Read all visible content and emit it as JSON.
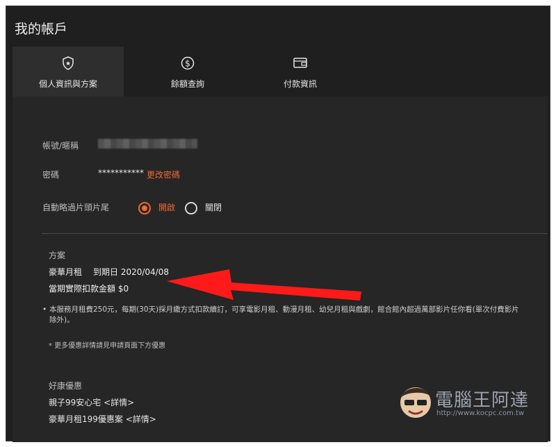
{
  "page": {
    "title": "我的帳戶"
  },
  "tabs": [
    {
      "label": "個人資訊與方案",
      "icon": "shield-icon",
      "active": true
    },
    {
      "label": "餘額查詢",
      "icon": "dollar-icon",
      "active": false
    },
    {
      "label": "付款資訊",
      "icon": "wallet-icon",
      "active": false
    }
  ],
  "account": {
    "nickname_label": "帳號/暱稱",
    "password_label": "密碼",
    "password_value": "***********",
    "change_password": "更改密碼",
    "skip_label": "自動略過片頭片尾",
    "skip_on": "開啟",
    "skip_off": "關閉",
    "skip_selected": "on"
  },
  "plan": {
    "section_label": "方案",
    "name": "豪華月租",
    "expiry": "到期日 2020/04/08",
    "charge": "當期實際扣款金額 $0",
    "description": "本服務月租費250元，每期(30天)採月繳方式扣款續訂，可享電影月租、動漫月租、幼兒月租與戲劇，館合館內超過萬部影片任你看(單次付費影片除外)。",
    "note": "* 更多優惠詳情請見申請頁面下方優惠"
  },
  "promos": {
    "section_label": "好康優惠",
    "items": [
      "親子99安心宅 <詳情>",
      "豪華月租199優惠案 <詳情>"
    ]
  },
  "watermark": {
    "text": "電腦王阿達",
    "url": "http://www.kocpc.com.tw"
  },
  "colors": {
    "accent": "#f26b2e",
    "background": "#262626",
    "arrow": "#ff0000"
  }
}
